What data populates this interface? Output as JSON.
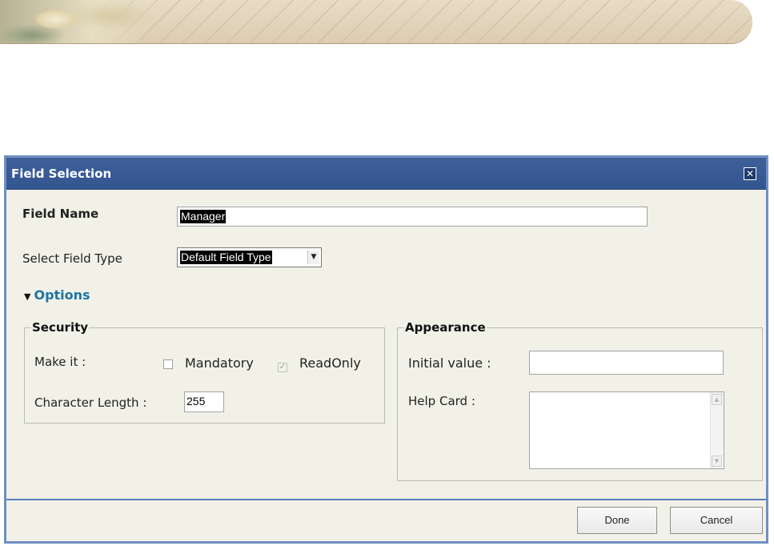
{
  "dialog": {
    "title": "Field Selection",
    "close_icon": "close-icon"
  },
  "field_name": {
    "label": "Field Name",
    "value": "Manager"
  },
  "field_type": {
    "label": "Select Field Type",
    "selected": "Default Field Type"
  },
  "options": {
    "label": "Options",
    "expanded": true
  },
  "security": {
    "legend": "Security",
    "make_it_label": "Make it :",
    "mandatory": {
      "label": "Mandatory",
      "checked": false
    },
    "readonly": {
      "label": "ReadOnly",
      "checked": true,
      "disabled": true
    },
    "char_length_label": "Character Length :",
    "char_length_value": "255"
  },
  "appearance": {
    "legend": "Appearance",
    "initial_value_label": "Initial value :",
    "initial_value": "",
    "help_card_label": "Help Card :",
    "help_card_value": ""
  },
  "buttons": {
    "done": "Done",
    "cancel": "Cancel"
  }
}
